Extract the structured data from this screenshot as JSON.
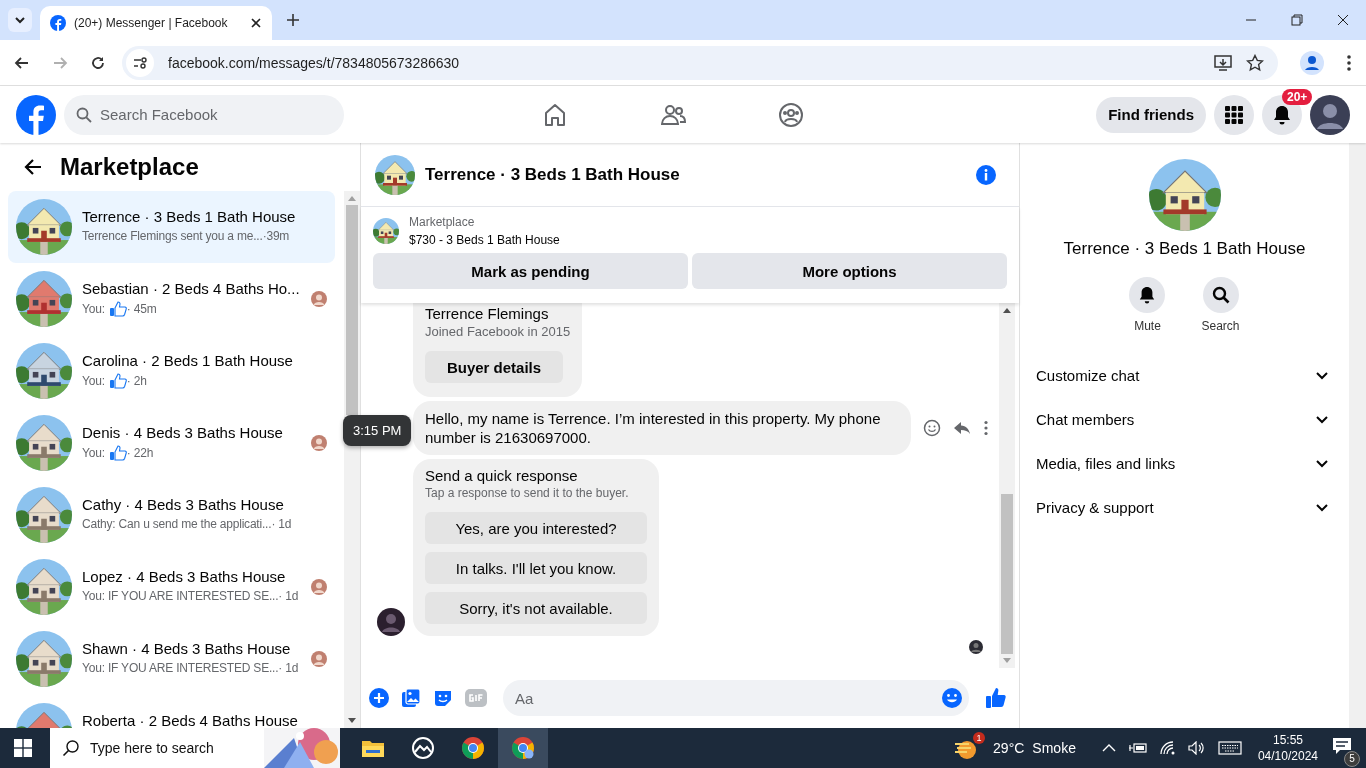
{
  "browser": {
    "tab_title": "(20+) Messenger | Facebook",
    "url": "facebook.com/messages/t/7834805673286630",
    "forward_disabled": true
  },
  "header": {
    "search_placeholder": "Search Facebook",
    "find_friends": "Find friends",
    "notification_badge": "20+"
  },
  "sidebar": {
    "title": "Marketplace",
    "conversations": [
      {
        "title": "Terrence · 3 Beds 1 Bath House",
        "kind": "text",
        "preview": "Terrence Flemings sent you a me...",
        "time": " ·39m",
        "selected": true,
        "seen": false
      },
      {
        "title": "Sebastian · 2 Beds 4 Baths Ho...",
        "kind": "like",
        "preview": "You:",
        "time": " · 45m",
        "selected": false,
        "seen": true
      },
      {
        "title": "Carolina · 2 Beds 1 Bath House",
        "kind": "like",
        "preview": "You:",
        "time": " · 2h",
        "selected": false,
        "seen": false
      },
      {
        "title": "Denis · 4 Beds 3 Baths House",
        "kind": "like",
        "preview": "You:",
        "time": " · 22h",
        "selected": false,
        "seen": true
      },
      {
        "title": "Cathy · 4 Beds 3 Baths House",
        "kind": "text",
        "preview": "Cathy: Can u send me the applicati...",
        "time": " · 1d",
        "selected": false,
        "seen": false
      },
      {
        "title": "Lopez · 4 Beds 3 Baths House",
        "kind": "text",
        "preview": "You: IF YOU ARE INTERESTED SE...",
        "time": " · 1d",
        "selected": false,
        "seen": true
      },
      {
        "title": "Shawn · 4 Beds 3 Baths House",
        "kind": "text",
        "preview": "You: IF YOU ARE INTERESTED SE...",
        "time": " · 1d",
        "selected": false,
        "seen": true
      },
      {
        "title": "Roberta · 2 Beds 4 Baths House",
        "selected": false,
        "seen": false
      }
    ]
  },
  "chat": {
    "title": "Terrence · 3 Beds 1 Bath House",
    "listing": {
      "label": "Marketplace",
      "title": "$730 - 3 Beds 1 Bath House",
      "actions": [
        "Mark as pending",
        "More options"
      ]
    },
    "buyer_card": {
      "name": "Terrence Flemings",
      "joined": "Joined Facebook in 2015",
      "button": "Buyer details"
    },
    "message": {
      "text": "Hello, my name is Terrence. I’m interested in this property. My phone number is 21630697000.",
      "time": "3:15 PM"
    },
    "quick_response": {
      "title": "Send a quick response",
      "hint": "Tap a response to send it to the buyer.",
      "options": [
        "Yes, are you interested?",
        "In talks. I'll let you know.",
        "Sorry, it's not available."
      ]
    },
    "composer": {
      "placeholder": "Aa"
    }
  },
  "details": {
    "title": "Terrence · 3 Beds 1 Bath House",
    "actions": [
      {
        "label": "Mute",
        "kind": "bell"
      },
      {
        "label": "Search",
        "kind": "search"
      }
    ],
    "sections": [
      {
        "label": "Customize chat",
        "expanded": false
      },
      {
        "label": "Chat members",
        "expanded": false
      },
      {
        "label": "Media, files and links",
        "expanded": false
      },
      {
        "label": "Privacy & support",
        "expanded": false
      }
    ]
  },
  "taskbar": {
    "search_placeholder": "Type here to search",
    "weather_badge": "1",
    "temperature": "29°C",
    "condition": "Smoke",
    "time": "15:55",
    "date": "04/10/2024",
    "notification_count": "5"
  }
}
